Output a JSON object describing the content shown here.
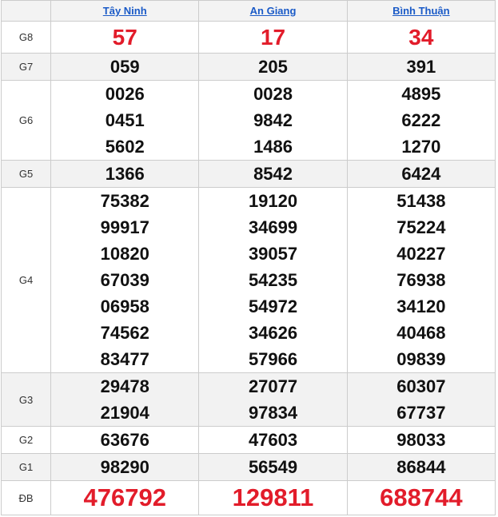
{
  "provinces": [
    "Tây Ninh",
    "An Giang",
    "Bình Thuận"
  ],
  "prizes": [
    {
      "label": "G8",
      "style": "big",
      "values": [
        [
          "57"
        ],
        [
          "17"
        ],
        [
          "34"
        ]
      ]
    },
    {
      "label": "G7",
      "style": "normal",
      "values": [
        [
          "059"
        ],
        [
          "205"
        ],
        [
          "391"
        ]
      ]
    },
    {
      "label": "G6",
      "style": "normal",
      "values": [
        [
          "0026",
          "0451",
          "5602"
        ],
        [
          "0028",
          "9842",
          "1486"
        ],
        [
          "4895",
          "6222",
          "1270"
        ]
      ]
    },
    {
      "label": "G5",
      "style": "normal",
      "values": [
        [
          "1366"
        ],
        [
          "8542"
        ],
        [
          "6424"
        ]
      ]
    },
    {
      "label": "G4",
      "style": "normal",
      "values": [
        [
          "75382",
          "99917",
          "10820",
          "67039",
          "06958",
          "74562",
          "83477"
        ],
        [
          "19120",
          "34699",
          "39057",
          "54235",
          "54972",
          "34626",
          "57966"
        ],
        [
          "51438",
          "75224",
          "40227",
          "76938",
          "34120",
          "40468",
          "09839"
        ]
      ]
    },
    {
      "label": "G3",
      "style": "normal",
      "values": [
        [
          "29478",
          "21904"
        ],
        [
          "27077",
          "97834"
        ],
        [
          "60307",
          "67737"
        ]
      ]
    },
    {
      "label": "G2",
      "style": "normal",
      "values": [
        [
          "63676"
        ],
        [
          "47603"
        ],
        [
          "98033"
        ]
      ]
    },
    {
      "label": "G1",
      "style": "normal",
      "values": [
        [
          "98290"
        ],
        [
          "56549"
        ],
        [
          "86844"
        ]
      ]
    },
    {
      "label": "ĐB",
      "style": "db",
      "values": [
        [
          "476792"
        ],
        [
          "129811"
        ],
        [
          "688744"
        ]
      ]
    }
  ],
  "colors": {
    "accent_red": "#e21c2a",
    "link_blue": "#1a5ac7",
    "stripe_gray": "#f2f2f2"
  }
}
